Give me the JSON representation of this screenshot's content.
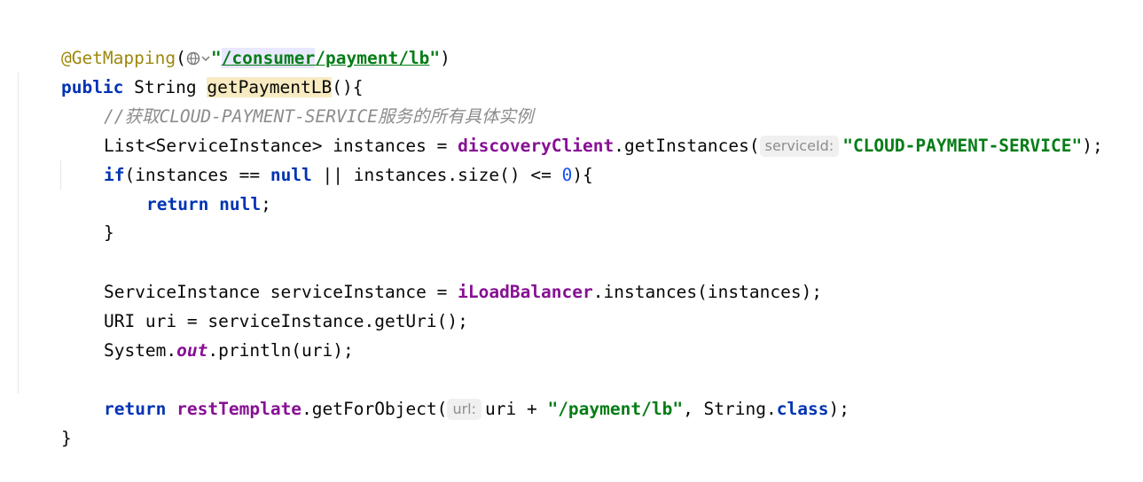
{
  "code": {
    "l1": {
      "anno": "@GetMapping",
      "open": "(",
      "q1": "\"",
      "url_a": "/consumer",
      "url_b": "/payment/lb",
      "q2": "\"",
      "close": ")"
    },
    "l2": {
      "kw": "public",
      "type": " String ",
      "method": "getPaymentLB",
      "rest": "(){"
    },
    "l3": {
      "comment": "//获取CLOUD-PAYMENT-SERVICE服务的所有具体实例"
    },
    "l4": {
      "a": "List<ServiceInstance> instances = ",
      "field": "discoveryClient",
      "b": ".getInstances(",
      "hint": "serviceId:",
      "str": "\"CLOUD-PAYMENT-SERVICE\"",
      "c": ");"
    },
    "l5": {
      "kw": "if",
      "a": "(instances == ",
      "kw2": "null",
      "b": " || instances.size() <= ",
      "num": "0",
      "c": "){"
    },
    "l6": {
      "kw": "return",
      "sp": " ",
      "kw2": "null",
      "c": ";"
    },
    "l7": {
      "c": "}"
    },
    "l8": {
      "a": "ServiceInstance serviceInstance = ",
      "field": "iLoadBalancer",
      "b": ".instances(instances);"
    },
    "l9": {
      "a": "URI uri = serviceInstance.getUri();"
    },
    "l10": {
      "a": "System.",
      "stat": "out",
      "b": ".println(uri);"
    },
    "l11": {
      "kw": "return",
      "sp": " ",
      "field": "restTemplate",
      "a": ".getForObject(",
      "hint": "url:",
      "b": "uri + ",
      "str": "\"/payment/lb\"",
      "c": ", String.",
      "kw2": "class",
      "d": ");"
    },
    "l12": {
      "c": "}"
    }
  },
  "icons": {
    "globe": "globe-icon",
    "chevron": "chevron-down-icon"
  }
}
